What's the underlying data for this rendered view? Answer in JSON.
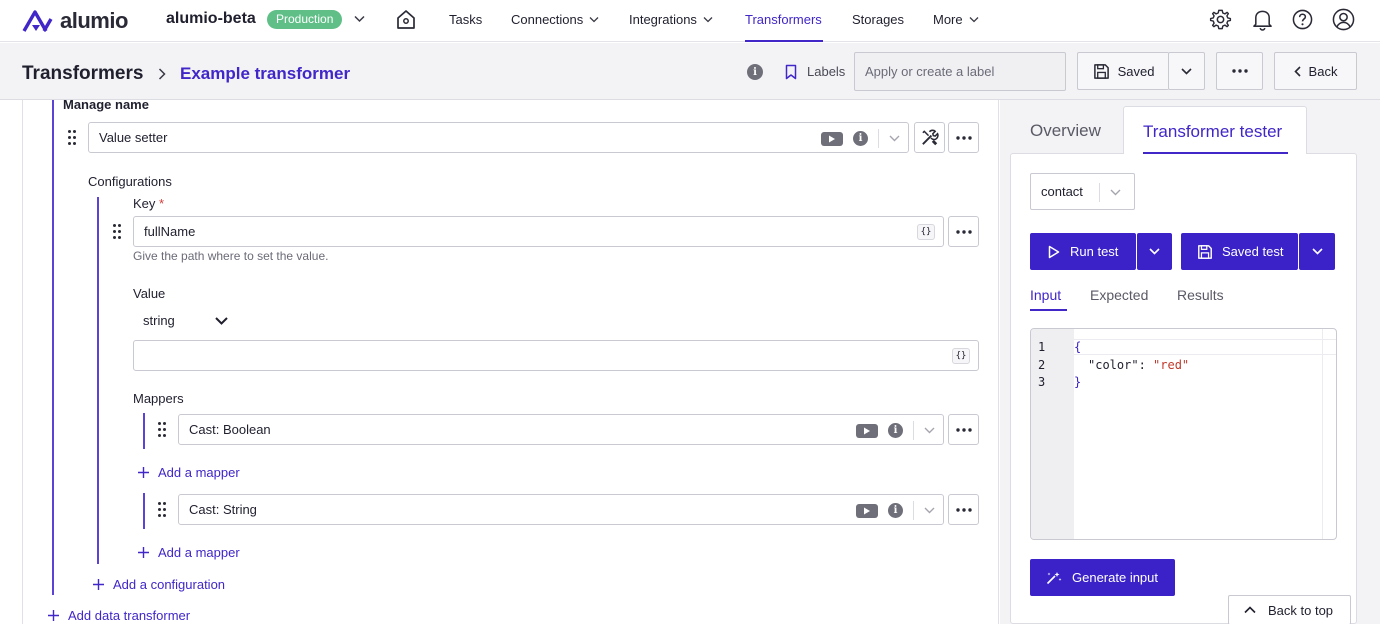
{
  "app": {
    "logo_text": "alumio",
    "environment_name": "alumio-beta",
    "environment_badge": "Production"
  },
  "nav": {
    "items": [
      {
        "label": "Tasks",
        "has_dropdown": false,
        "active": false
      },
      {
        "label": "Connections",
        "has_dropdown": true,
        "active": false
      },
      {
        "label": "Integrations",
        "has_dropdown": true,
        "active": false
      },
      {
        "label": "Transformers",
        "has_dropdown": false,
        "active": true
      },
      {
        "label": "Storages",
        "has_dropdown": false,
        "active": false
      },
      {
        "label": "More",
        "has_dropdown": true,
        "active": false
      }
    ],
    "icons": [
      "home-icon",
      "gear-icon",
      "bell-icon",
      "help-icon",
      "user-icon"
    ]
  },
  "header": {
    "breadcrumb_root": "Transformers",
    "breadcrumb_current": "Example transformer",
    "labels_label": "Labels",
    "label_placeholder": "Apply or create a label",
    "saved_label": "Saved",
    "back_label": "Back"
  },
  "editor": {
    "section_label": "Manage name",
    "transformer_value": "Value setter",
    "configurations_label": "Configurations",
    "key_label": "Key",
    "key_required_mark": "*",
    "key_value": "fullName",
    "key_hint": "Give the path where to set the value.",
    "value_label": "Value",
    "value_type": "string",
    "value_value": "",
    "mappers_label": "Mappers",
    "mappers": [
      {
        "value": "Cast: Boolean"
      },
      {
        "value": "Cast: String"
      }
    ],
    "add_mapper_label": "Add a mapper",
    "add_configuration_label": "Add a configuration",
    "add_data_transformer_label": "Add data transformer",
    "braces_glyph": "{}"
  },
  "tester": {
    "tabs": [
      {
        "label": "Overview",
        "active": false
      },
      {
        "label": "Transformer tester",
        "active": true
      }
    ],
    "entity_select": "contact",
    "run_test_label": "Run test",
    "saved_test_label": "Saved test",
    "subtabs": [
      {
        "label": "Input",
        "active": true
      },
      {
        "label": "Expected",
        "active": false
      },
      {
        "label": "Results",
        "active": false
      }
    ],
    "code_line_numbers": [
      "1",
      "2",
      "3"
    ],
    "code": {
      "open_brace": "{",
      "key": "\"color\"",
      "colon": ": ",
      "value": "\"red\"",
      "close_brace": "}"
    },
    "generate_input_label": "Generate input",
    "back_to_top_label": "Back to top"
  },
  "colors": {
    "brand": "#4126c8",
    "primary_button": "#3b22c8",
    "badge": "#5fbf87",
    "code_string": "#c0392b",
    "code_brace": "#3b22c8"
  }
}
